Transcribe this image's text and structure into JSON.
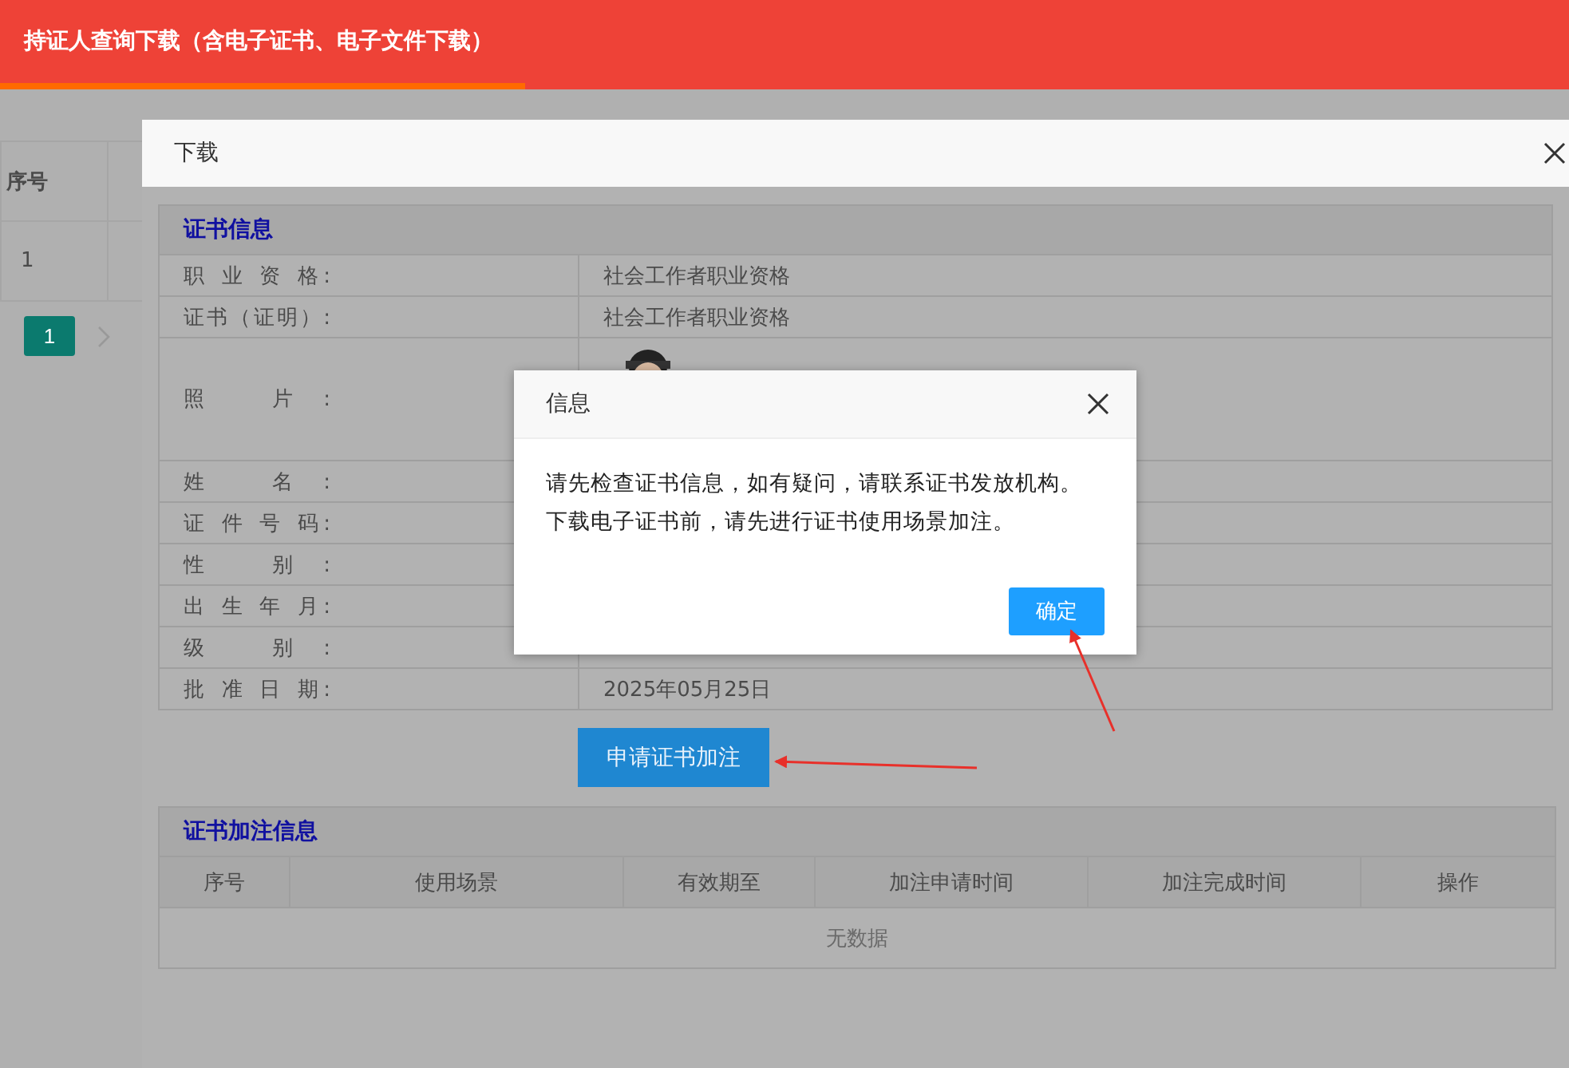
{
  "header": {
    "title": "持证人查询下载（含电子证书、电子文件下载）"
  },
  "background_table": {
    "columns": [
      "序号"
    ],
    "rows": [
      [
        "1"
      ]
    ]
  },
  "pagination": {
    "pages": [
      {
        "label": "1",
        "selected": true
      }
    ]
  },
  "download_dialog": {
    "title": "下载",
    "certificate_section": {
      "title": "证书信息",
      "rows": [
        {
          "kind": "text",
          "label": "职 业 资 格:",
          "value": "社会工作者职业资格"
        },
        {
          "kind": "text",
          "label": "证书（证明）:",
          "value": "社会工作者职业资格"
        },
        {
          "label": "照 片:"
        },
        {
          "kind": "text",
          "label": "姓 名:"
        },
        {
          "kind": "text",
          "label": "证 件 号 码:"
        },
        {
          "kind": "text",
          "label": "性 别:"
        },
        {
          "kind": "text",
          "label": "出 生 年 月:"
        },
        {
          "kind": "text",
          "label": "级 别:"
        },
        {
          "kind": "text",
          "label": "批 准 日 期:",
          "value": "2025年05月25日"
        }
      ]
    },
    "apply_button": "申请证书加注",
    "annotation_section": {
      "title": "证书加注信息",
      "columns": [
        "序号",
        "使用场景",
        "有效期至",
        "加注申请时间",
        "加注完成时间",
        "操作"
      ],
      "empty_text": "无数据"
    }
  },
  "info_dialog": {
    "title": "信息",
    "lines": [
      "请先检查证书信息，如有疑问，请联系证书发放机构。",
      "下载电子证书前，请先进行证书使用场景加注。"
    ],
    "button": "确定"
  }
}
